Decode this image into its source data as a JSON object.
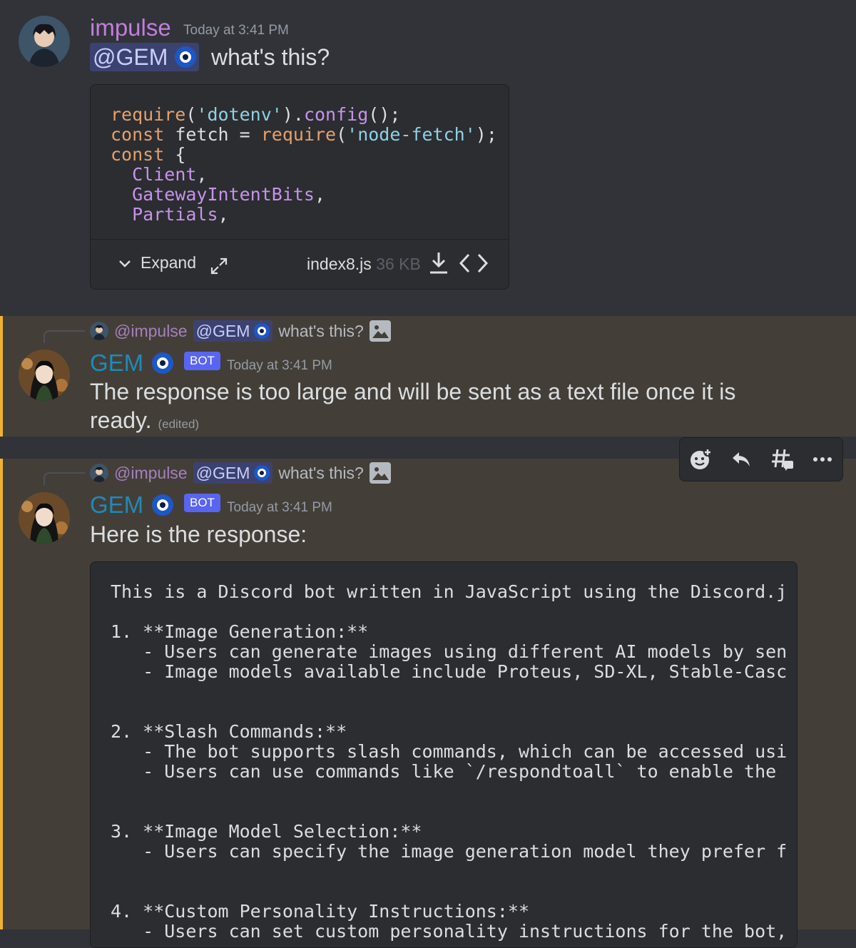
{
  "message1": {
    "author": "impulse",
    "author_color": "#c27edb",
    "timestamp": "Today at 3:41 PM",
    "mention": "@GEM",
    "text": "what's this?",
    "attachment": {
      "code_lines": [
        [
          {
            "t": "require",
            "c": "k"
          },
          {
            "t": "(",
            "c": "w"
          },
          {
            "t": "'dotenv'",
            "c": "s"
          },
          {
            "t": ").",
            "c": "w"
          },
          {
            "t": "config",
            "c": "p"
          },
          {
            "t": "();",
            "c": "w"
          }
        ],
        [
          {
            "t": "const",
            "c": "k"
          },
          {
            "t": " fetch = ",
            "c": "w"
          },
          {
            "t": "require",
            "c": "k"
          },
          {
            "t": "(",
            "c": "w"
          },
          {
            "t": "'node-fetch'",
            "c": "s"
          },
          {
            "t": ");",
            "c": "w"
          }
        ],
        [
          {
            "t": "const",
            "c": "k"
          },
          {
            "t": " {",
            "c": "w"
          }
        ],
        [
          {
            "t": "  ",
            "c": "w"
          },
          {
            "t": "Client",
            "c": "p"
          },
          {
            "t": ",",
            "c": "w"
          }
        ],
        [
          {
            "t": "  ",
            "c": "w"
          },
          {
            "t": "GatewayIntentBits",
            "c": "p"
          },
          {
            "t": ",",
            "c": "w"
          }
        ],
        [
          {
            "t": "  ",
            "c": "w"
          },
          {
            "t": "Partials",
            "c": "p"
          },
          {
            "t": ",",
            "c": "w"
          }
        ]
      ],
      "expand_label": "Expand",
      "filename": "index8.js",
      "filesize": "36 KB"
    }
  },
  "message2": {
    "reply": {
      "author": "@impulse",
      "mention": "@GEM",
      "text": "what's this?"
    },
    "author": "GEM",
    "author_color": "#1f8ab8",
    "bot_tag": "BOT",
    "timestamp": "Today at 3:41 PM",
    "text_line1": "The response is too large and will be sent as a text file once it is",
    "text_line2": "ready.",
    "edited": "(edited)"
  },
  "message3": {
    "reply": {
      "author": "@impulse",
      "mention": "@GEM",
      "text": "what's this?"
    },
    "author": "GEM",
    "author_color": "#1f8ab8",
    "bot_tag": "BOT",
    "timestamp": "Today at 3:41 PM",
    "text": "Here is the response:",
    "attachment_lines": [
      "This is a Discord bot written in JavaScript using the Discord.js",
      "",
      "1. **Image Generation:**",
      "   - Users can generate images using different AI models by sendi",
      "   - Image models available include Proteus, SD-XL, Stable-Cascad",
      "",
      "",
      "2. **Slash Commands:**",
      "   - The bot supports slash commands, which can be accessed using",
      "   - Users can use commands like `/respondtoall` to enable the bo",
      "",
      "",
      "3. **Image Model Selection:**",
      "   - Users can specify the image generation model they prefer for",
      "",
      "",
      "4. **Custom Personality Instructions:**",
      "   - Users can set custom personality instructions for the bot, "
    ]
  },
  "toolbar": {
    "icons": [
      "add-reaction-icon",
      "reply-icon",
      "create-thread-icon",
      "more-icon"
    ]
  }
}
